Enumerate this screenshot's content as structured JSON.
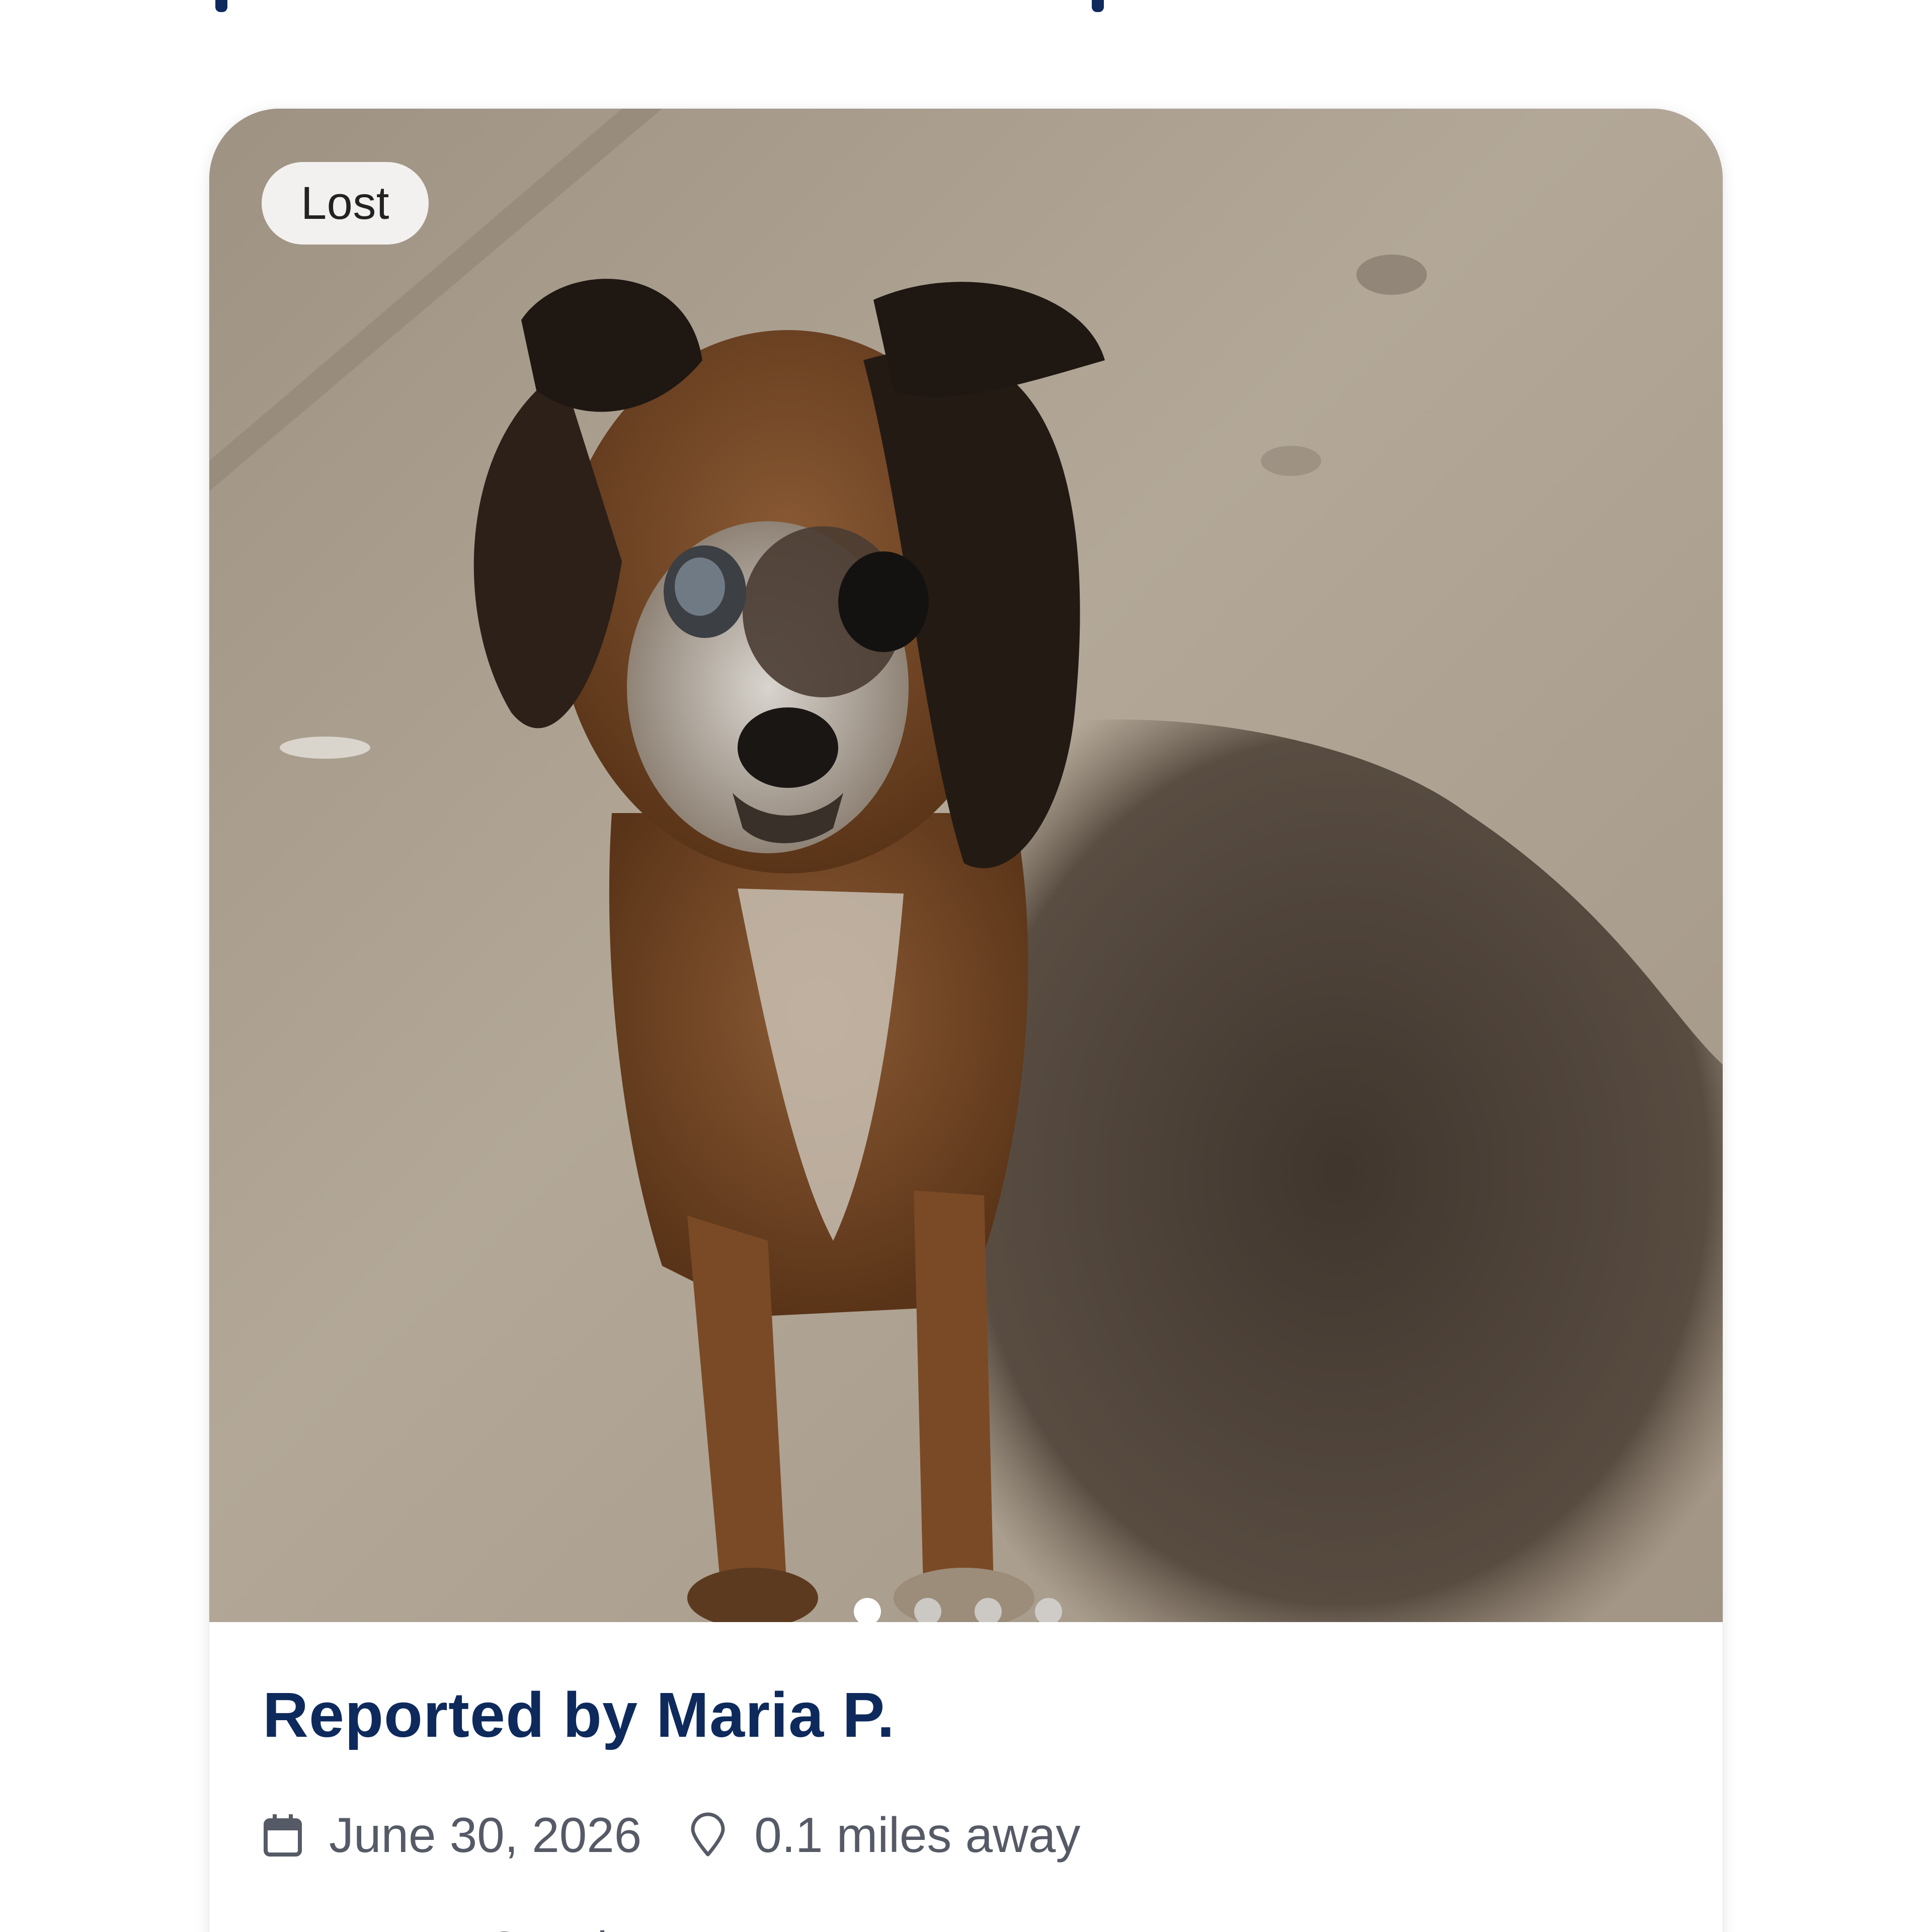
{
  "listing": {
    "status": "Lost",
    "photo_count": 4,
    "active_photo_index": 0,
    "reported_by": "Reported by Maria P.",
    "date": "June 30, 2026",
    "distance": "0.1 miles away",
    "pet_name_line": "Pet name: Canela"
  },
  "icons": {
    "date": "calendar-icon",
    "distance": "location-pin-icon"
  },
  "colors": {
    "heading_navy": "#0e2a5c",
    "meta_gray": "#555a66",
    "chip_bg": "#f3f1ef"
  }
}
